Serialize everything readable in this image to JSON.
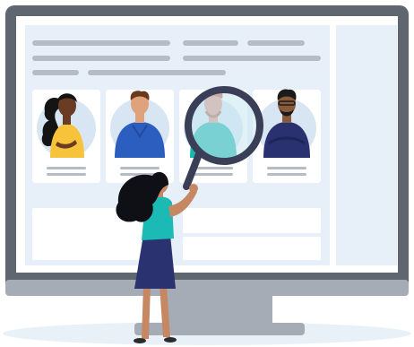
{
  "illustration": {
    "kind": "monitor-with-people-profiles",
    "colors": {
      "monitor_frame": "#5f6670",
      "monitor_stand": "#a5acb6",
      "screen_bg": "#e7eff8",
      "card_bg": "#ffffff",
      "placeholder_line": "#b5bcc6",
      "avatar_circle": "#d8e6f3",
      "lens_tint": "#c9e8f0",
      "magnifier_frame": "#3a3f57",
      "woman_top": "#1cbab4",
      "woman_skirt": "#2b3270",
      "woman_hair": "#0f0f16",
      "woman_skin": "#c58863"
    },
    "profile_cards": [
      {
        "person": "woman-yellow-top",
        "shirt_color": "#f6c33a",
        "skin_color": "#6a3c23",
        "hair_color": "#141414"
      },
      {
        "person": "man-blue-shirt",
        "shirt_color": "#2c5ec0",
        "skin_color": "#e0a27d",
        "hair_color": "#6b3a1c"
      },
      {
        "person": "man-teal-shirt-magnified",
        "shirt_color": "#1ab6b0",
        "skin_color": "#d9988a",
        "hair_color": "#c4614a"
      },
      {
        "person": "man-navy-shirt-glasses",
        "shirt_color": "#2a3170",
        "skin_color": "#8a5a3a",
        "hair_color": "#1b1b1b"
      }
    ],
    "icons": [
      "magnifying-glass-icon"
    ]
  }
}
